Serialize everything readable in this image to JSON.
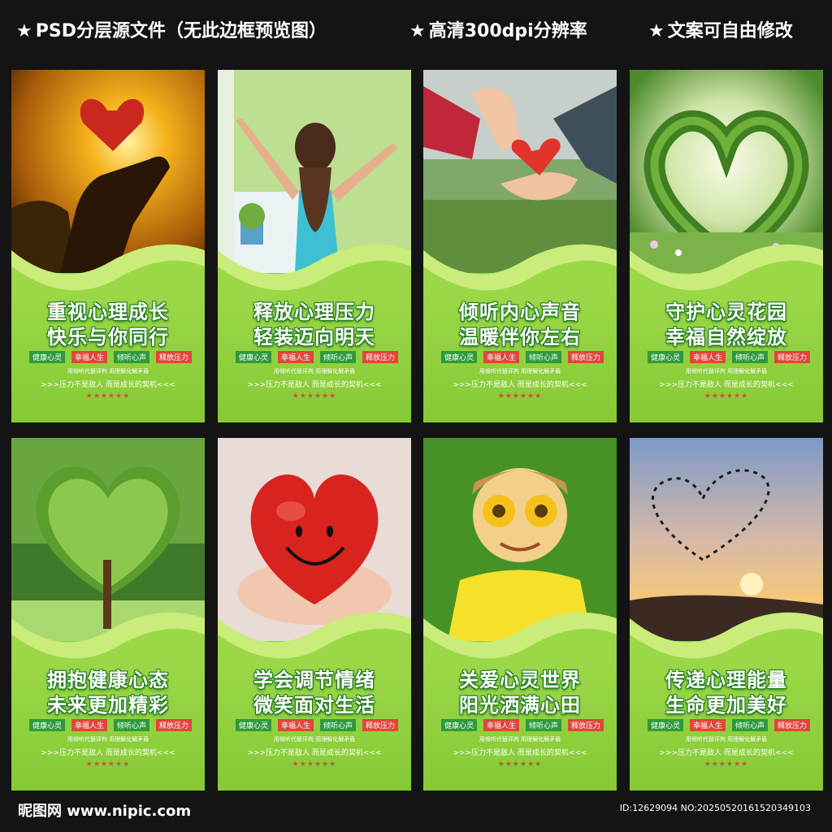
{
  "banner": {
    "items": [
      {
        "star": "★",
        "text": "PSD分层源文件（无此边框预览图）"
      },
      {
        "star": "★",
        "text": "高清300dpi分辨率"
      },
      {
        "star": "★",
        "text": "文案可自由修改"
      }
    ]
  },
  "colors": {
    "background": "#141414",
    "panel_green": "#8fd23d",
    "tag_green": "#2e9a3c",
    "tag_red": "#e0463a",
    "title_outline": "#1f7a1f"
  },
  "cards": [
    {
      "image": "heart-in-hand-sunset",
      "title1": "重视心理成长",
      "title2": "快乐与你同行"
    },
    {
      "image": "girl-open-window",
      "title1": "释放心理压力",
      "title2": "轻装迈向明天"
    },
    {
      "image": "hands-paper-heart",
      "title1": "倾听内心声音",
      "title2": "温暖伴你左右"
    },
    {
      "image": "heart-shaped-garden",
      "title1": "守护心灵花园",
      "title2": "幸福自然绽放"
    },
    {
      "image": "heart-shaped-tree",
      "title1": "拥抱健康心态",
      "title2": "未来更加精彩"
    },
    {
      "image": "smiling-red-heart",
      "title1": "学会调节情绪",
      "title2": "微笑面对生活"
    },
    {
      "image": "child-sunflower-eyes",
      "title1": "关爱心灵世界",
      "title2": "阳光洒满心田"
    },
    {
      "image": "bird-flock-heart-sunset",
      "title1": "传递心理能量",
      "title2": "生命更加美好"
    }
  ],
  "tags": [
    "健康心灵",
    "幸福人生",
    "倾听心声",
    "释放压力"
  ],
  "line1": "用倾听代替评判 用理解化解矛盾",
  "line2": ">>>压力不是敌人 而是成长的契机<<<",
  "stars": "★★★★★★",
  "footer": {
    "logo": "昵图网 www.nipic.com",
    "id": "ID:12629094 NO:20250520161520349103"
  }
}
